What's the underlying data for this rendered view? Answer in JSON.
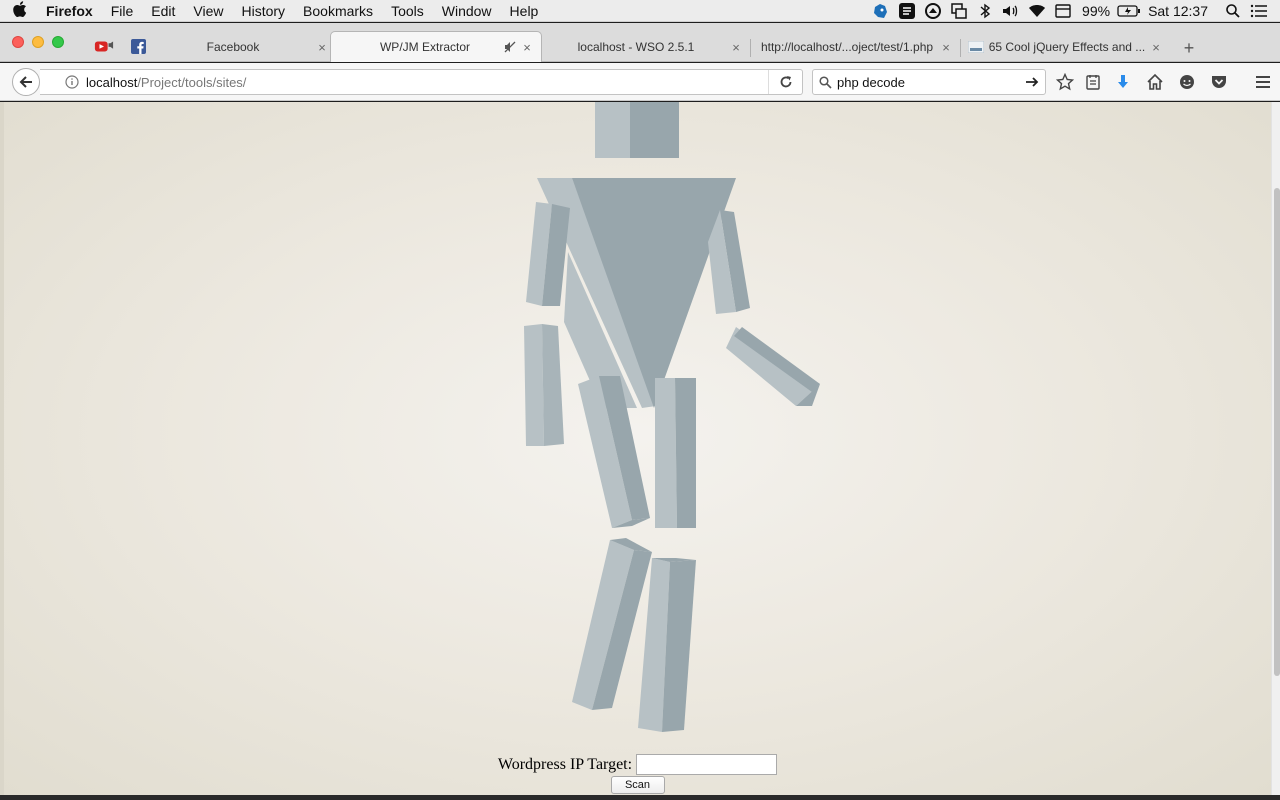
{
  "menubar": {
    "apple_icon": "apple-icon",
    "app_name": "Firefox",
    "items": [
      "File",
      "Edit",
      "View",
      "History",
      "Bookmarks",
      "Tools",
      "Window",
      "Help"
    ],
    "battery": "99%",
    "clock": "Sat 12:37"
  },
  "tabs": {
    "items": [
      {
        "title": "Facebook",
        "close": "×"
      },
      {
        "title": "WP/JM Extractor",
        "close": "×"
      },
      {
        "title": "localhost - WSO 2.5.1",
        "close": "×"
      },
      {
        "title": "http://localhost/...oject/test/1.php",
        "close": "×"
      },
      {
        "title": "65 Cool jQuery Effects and ...",
        "close": "×"
      }
    ],
    "new_tab": "+"
  },
  "navbar": {
    "url_host": "localhost",
    "url_path": "/Project/tools/sites/",
    "search_value": "php decode"
  },
  "page": {
    "form_label": "Wordpress IP Target:",
    "input_value": "",
    "scan_label": "Scan"
  },
  "colors": {
    "robot_light": "#b7c1c5",
    "robot_dark": "#98a6ac",
    "robot_mid": "#a8b4b9",
    "background": "#ece8df"
  }
}
